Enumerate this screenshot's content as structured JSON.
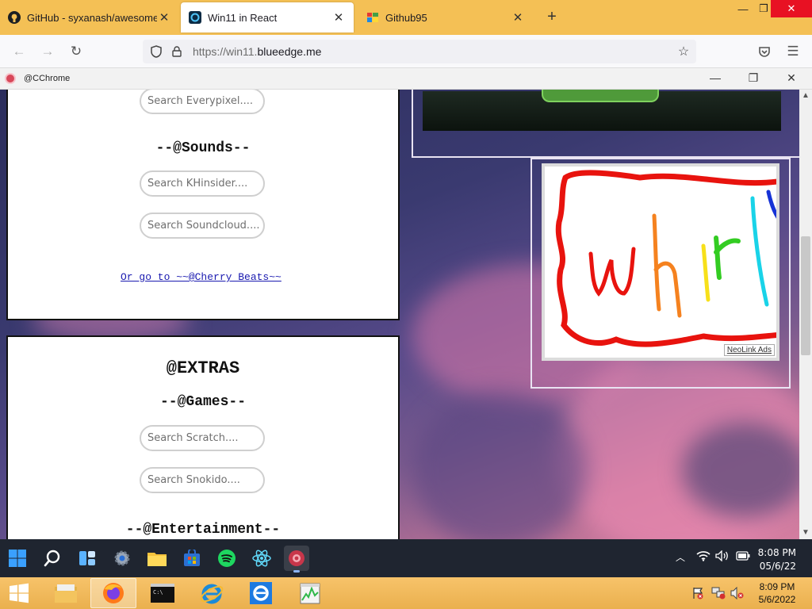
{
  "browser": {
    "tabs": [
      {
        "title": "GitHub - syxanash/awesome-w",
        "icon": "github-icon"
      },
      {
        "title": "Win11 in React",
        "icon": "win11-icon",
        "active": true
      },
      {
        "title": "Github95",
        "icon": "windows95-icon"
      }
    ],
    "url_protocol": "https://win11.",
    "url_host": "blueedge.me"
  },
  "inner_window": {
    "title": "@CChrome"
  },
  "page": {
    "top_panel": {
      "search_everypixel": "Search Everypixel....",
      "sounds_heading": "--@Sounds--",
      "search_khinsider": "Search KHinsider....",
      "search_soundcloud": "Search Soundcloud....",
      "cherry_link": "Or go to ~~@Cherry Beats~~"
    },
    "extras_panel": {
      "heading": "@EXTRAS",
      "games_heading": "--@Games--",
      "search_scratch": "Search Scratch....",
      "search_snokido": "Search Snokido....",
      "entertainment_heading": "--@Entertainment--"
    },
    "ad": {
      "label": "NeoLink Ads"
    }
  },
  "win11_taskbar": {
    "time": "8:08 PM",
    "date": "05/6/22"
  },
  "win8_taskbar": {
    "time": "8:09 PM",
    "date": "5/6/2022"
  },
  "colors": {
    "firefox_tabbar": "#f4c055",
    "close_red": "#e81123",
    "link_blue": "#1a1ab0",
    "win11_taskbar": "#1f2530"
  }
}
